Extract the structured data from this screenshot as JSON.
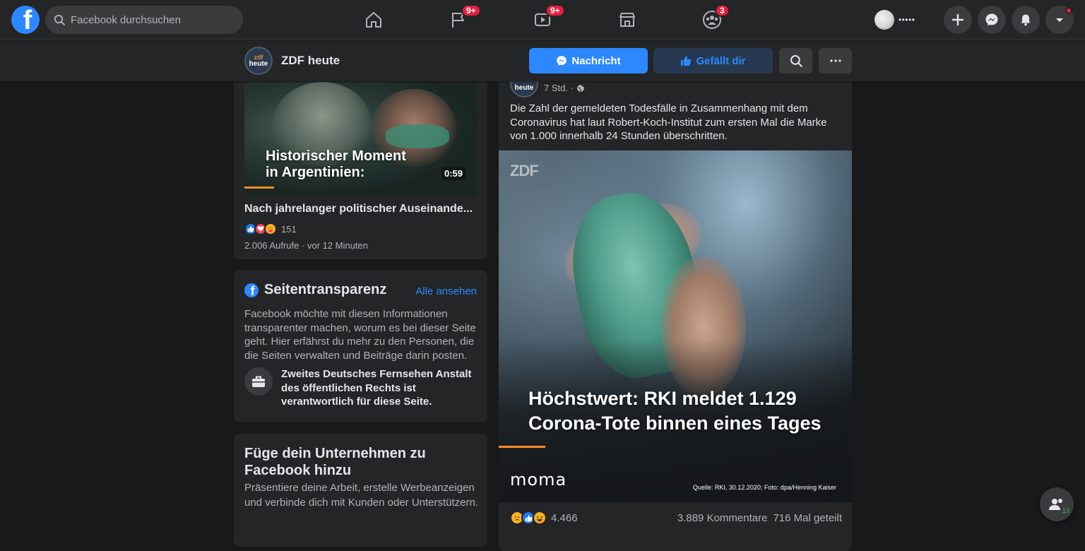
{
  "topbar": {
    "search_placeholder": "Facebook durchsuchen",
    "nav": [
      {
        "name": "home",
        "badge": ""
      },
      {
        "name": "pages",
        "badge": "9+"
      },
      {
        "name": "watch",
        "badge": "9+"
      },
      {
        "name": "marketplace",
        "badge": ""
      },
      {
        "name": "groups",
        "badge": "3"
      }
    ],
    "profile_name": "•••••"
  },
  "page_header": {
    "avatar_zdf": "zdf",
    "avatar_heute": "heute",
    "name": "ZDF heute",
    "message_label": "Nachricht",
    "like_label": "Gefällt dir"
  },
  "video_card": {
    "overlay_title_line1": "Historischer Moment",
    "overlay_title_line2": "in Argentinien:",
    "duration": "0:59",
    "title": "Nach jahrelanger politischer Auseinande...",
    "reaction_count": "151",
    "meta": "2.006 Aufrufe · vor 12 Minuten"
  },
  "transparency": {
    "title": "Seitentransparenz",
    "see_all": "Alle ansehen",
    "text": "Facebook möchte mit diesen Informationen transparenter machen, worum es bei dieser Seite geht. Hier erfährst du mehr zu den Personen, die die Seiten verwalten und Beiträge darin posten.",
    "responsible": "Zweites Deutsches Fernsehen Anstalt des öffentlichen Rechts ist verantwortlich für diese Seite."
  },
  "business": {
    "title": "Füge dein Unternehmen zu Facebook hinzu",
    "text": "Präsentiere deine Arbeit, erstelle Werbeanzeigen und verbinde dich mit Kunden oder Unterstützern."
  },
  "post": {
    "avatar_heute": "heute",
    "time": "7 Std. ·",
    "text": "Die Zahl der gemeldeten Todesfälle in Zusammenhang mit dem Coronavirus hat laut Robert-Koch-Institut zum ersten Mal die Marke von 1.000 innerhalb 24 Stunden überschritten.",
    "image_watermark": "ZDF",
    "image_headline": "Höchstwert: RKI meldet 1.129 Corona-Tote binnen eines Tages",
    "image_brand": "moma",
    "image_source": "Quelle: RKI, 30.12.2020; Foto: dpa/Henning Kaiser",
    "reaction_count": "4.466",
    "comments": "3.889 Kommentare",
    "shares": "716 Mal geteilt"
  },
  "contacts_fab_count": "13",
  "colors": {
    "accent": "#2d88ff",
    "badge": "#e41e3f",
    "zdf_orange": "#f28c28",
    "surface": "#242526",
    "background": "#18191a"
  }
}
